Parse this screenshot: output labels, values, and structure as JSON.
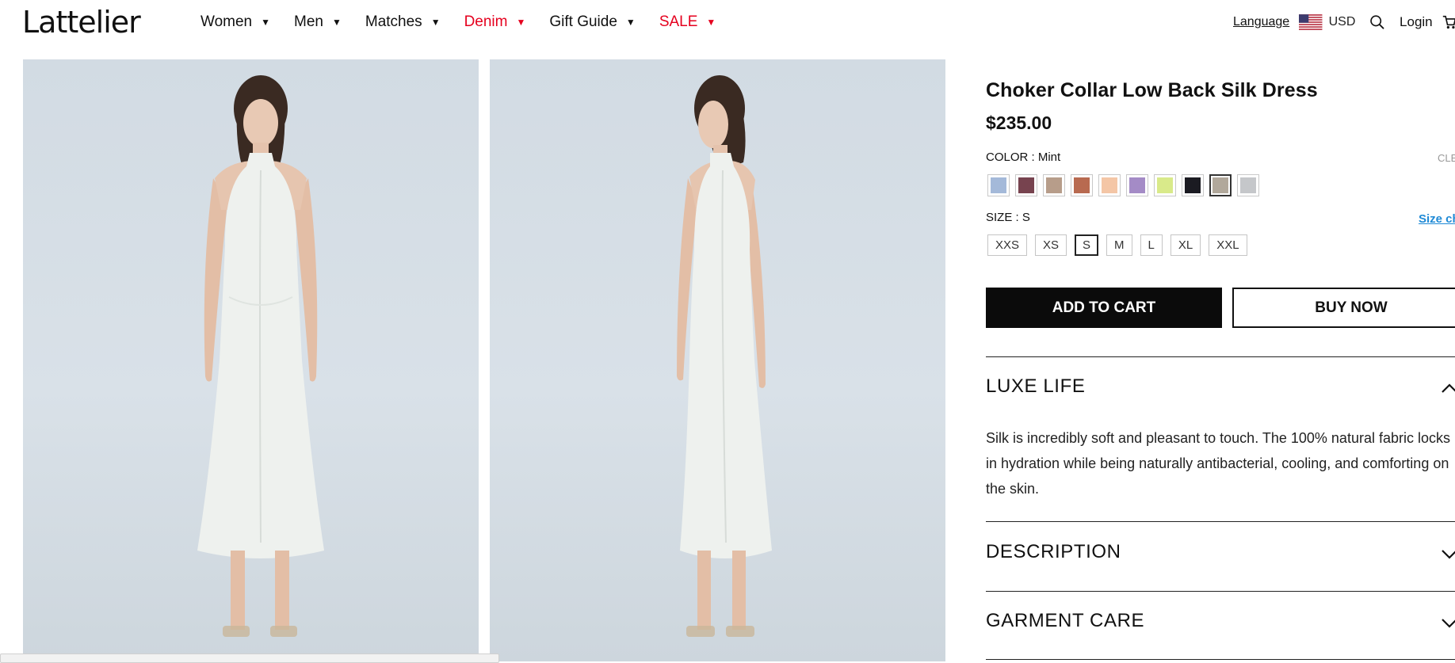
{
  "header": {
    "logo": "Lattelier",
    "nav": [
      {
        "label": "Women",
        "color": "#111111"
      },
      {
        "label": "Men",
        "color": "#111111"
      },
      {
        "label": "Matches",
        "color": "#111111"
      },
      {
        "label": "Denim",
        "color": "#e5001e"
      },
      {
        "label": "Gift Guide",
        "color": "#111111"
      },
      {
        "label": "SALE",
        "color": "#e5001e"
      }
    ],
    "language_label": "Language",
    "flag_icon": "us-flag-icon",
    "currency": "USD",
    "search_icon": "search-icon",
    "login_label": "Login",
    "cart_icon": "cart-icon"
  },
  "gallery": {
    "images": [
      {
        "name": "product-photo-front"
      },
      {
        "name": "product-photo-side"
      }
    ]
  },
  "product": {
    "title": "Choker Collar Low Back Silk Dress",
    "price": "$235.00",
    "color_label": "COLOR : Mint",
    "clear_label": "CLE",
    "swatches": [
      {
        "color": "#a4b9d9",
        "selected": false
      },
      {
        "color": "#77434f",
        "selected": false
      },
      {
        "color": "#b79d8a",
        "selected": false
      },
      {
        "color": "#b86a50",
        "selected": false
      },
      {
        "color": "#f4c6a6",
        "selected": false
      },
      {
        "color": "#a48bc6",
        "selected": false
      },
      {
        "color": "#d9ea8a",
        "selected": false
      },
      {
        "color": "#1b1b22",
        "selected": false
      },
      {
        "color": "#b1a89b",
        "selected": true
      },
      {
        "color": "#c5c7ca",
        "selected": false
      }
    ],
    "size_label": "SIZE : S",
    "size_chart_label": "Size ch",
    "sizes": [
      {
        "label": "XXS",
        "selected": false
      },
      {
        "label": "XS",
        "selected": false
      },
      {
        "label": "S",
        "selected": true
      },
      {
        "label": "M",
        "selected": false
      },
      {
        "label": "L",
        "selected": false
      },
      {
        "label": "XL",
        "selected": false
      },
      {
        "label": "XXL",
        "selected": false
      }
    ],
    "add_to_cart": "ADD TO CART",
    "buy_now": "BUY NOW",
    "accordions": [
      {
        "title": "LUXE LIFE",
        "expanded": true,
        "body": "Silk is incredibly soft and pleasant to touch. The 100% natural fabric locks in hydration while being naturally antibacterial, cooling, and comforting on the skin."
      },
      {
        "title": "DESCRIPTION",
        "expanded": false
      },
      {
        "title": "GARMENT CARE",
        "expanded": false
      }
    ]
  },
  "colors": {
    "accent_red": "#e5001e",
    "link_blue": "#1f8ad6",
    "button_black": "#0b0b0b"
  }
}
